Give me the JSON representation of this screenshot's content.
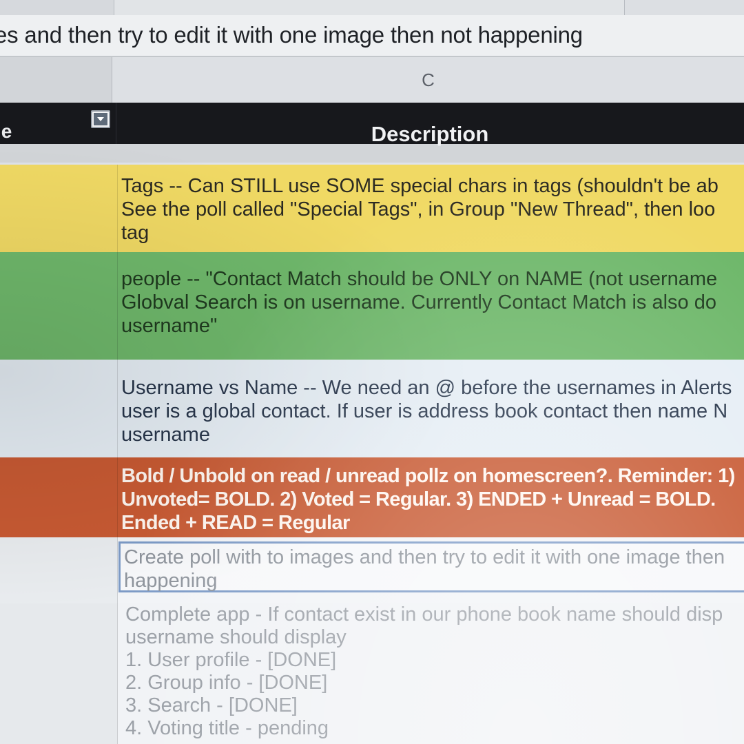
{
  "formula_bar": {
    "text": "es and then try to edit it with one image then not happening"
  },
  "column_headers": {
    "c": "C"
  },
  "table_header": {
    "left_label": "le",
    "description": "Description"
  },
  "rows": [
    {
      "color": "#f0d964",
      "lines": [
        "Tags -- Can STILL use SOME special chars in tags (shouldn't be ab",
        "See the poll called \"Special Tags\", in Group \"New Thread\", then loo",
        "tag"
      ]
    },
    {
      "color": "#6fb86b",
      "lines": [
        "people -- \"Contact Match should be ONLY on NAME (not username",
        "Globval Search is on username. Currently Contact Match is also do",
        "username\""
      ]
    },
    {
      "color": "#e6eef5",
      "lines": [
        "Username vs Name -- We need an @ before the usernames in Alerts",
        "user is a global contact. If user is address book contact then name N",
        "username"
      ]
    },
    {
      "color": "#c85a33",
      "lines": [
        "Bold / Unbold on read / unread pollz on homescreen?. Reminder: 1)",
        "Unvoted= BOLD. 2) Voted = Regular.  3) ENDED + Unread = BOLD.",
        "Ended + READ = Regular"
      ]
    },
    {
      "color": "#f2f4f7",
      "lines": [
        "Create poll with to images and then try to edit it with one image then",
        "happening"
      ]
    },
    {
      "color": "#f1f3f6",
      "lines": [
        "Complete app - If contact exist in our phone book name should disp",
        "username should display",
        "1. User profile - [DONE]",
        "2. Group info - [DONE]",
        "3. Search - [DONE]",
        "4. Voting title - pending"
      ]
    }
  ],
  "icons": {
    "filter": "filter-dropdown-icon"
  }
}
